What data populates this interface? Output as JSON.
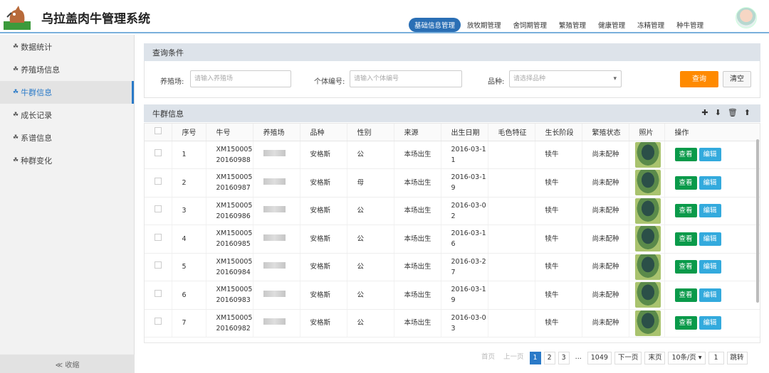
{
  "app": {
    "title": "乌拉盖肉牛管理系统"
  },
  "topnav": [
    "基础信息管理",
    "放牧期管理",
    "舍饲期管理",
    "繁殖管理",
    "健康管理",
    "冻精管理",
    "种牛管理"
  ],
  "sidebar": {
    "items": [
      {
        "label": "数据统计"
      },
      {
        "label": "养殖场信息"
      },
      {
        "label": "牛群信息"
      },
      {
        "label": "成长记录"
      },
      {
        "label": "系谱信息"
      },
      {
        "label": "种群变化"
      }
    ],
    "collapse_label": "≪ 收缩"
  },
  "query": {
    "title": "查询条件",
    "farm_label": "养殖场:",
    "farm_placeholder": "请输入养殖场",
    "id_label": "个体编号:",
    "id_placeholder": "请输入个体编号",
    "breed_label": "品种:",
    "breed_placeholder": "请选择品种",
    "query_btn": "查询",
    "clear_btn": "清空"
  },
  "table": {
    "title": "牛群信息",
    "headers": [
      "",
      "序号",
      "牛号",
      "养殖场",
      "品种",
      "性别",
      "来源",
      "出生日期",
      "毛色特征",
      "生长阶段",
      "繁殖状态",
      "照片",
      "操作"
    ],
    "view_label": "查看",
    "edit_label": "编辑",
    "rows": [
      {
        "no": "1",
        "id1": "XM150005",
        "id2": "20160988",
        "breed": "安格斯",
        "sex": "公",
        "source": "本场出生",
        "d1": "2016-03-1",
        "d2": "1",
        "coat": "",
        "stage": "犊牛",
        "status": "尚未配种"
      },
      {
        "no": "2",
        "id1": "XM150005",
        "id2": "20160987",
        "breed": "安格斯",
        "sex": "母",
        "source": "本场出生",
        "d1": "2016-03-1",
        "d2": "9",
        "coat": "",
        "stage": "犊牛",
        "status": "尚未配种"
      },
      {
        "no": "3",
        "id1": "XM150005",
        "id2": "20160986",
        "breed": "安格斯",
        "sex": "公",
        "source": "本场出生",
        "d1": "2016-03-0",
        "d2": "2",
        "coat": "",
        "stage": "犊牛",
        "status": "尚未配种"
      },
      {
        "no": "4",
        "id1": "XM150005",
        "id2": "20160985",
        "breed": "安格斯",
        "sex": "公",
        "source": "本场出生",
        "d1": "2016-03-1",
        "d2": "6",
        "coat": "",
        "stage": "犊牛",
        "status": "尚未配种"
      },
      {
        "no": "5",
        "id1": "XM150005",
        "id2": "20160984",
        "breed": "安格斯",
        "sex": "公",
        "source": "本场出生",
        "d1": "2016-03-2",
        "d2": "7",
        "coat": "",
        "stage": "犊牛",
        "status": "尚未配种"
      },
      {
        "no": "6",
        "id1": "XM150005",
        "id2": "20160983",
        "breed": "安格斯",
        "sex": "公",
        "source": "本场出生",
        "d1": "2016-03-1",
        "d2": "9",
        "coat": "",
        "stage": "犊牛",
        "status": "尚未配种"
      },
      {
        "no": "7",
        "id1": "XM150005",
        "id2": "20160982",
        "breed": "安格斯",
        "sex": "公",
        "source": "本场出生",
        "d1": "2016-03-0",
        "d2": "3",
        "coat": "",
        "stage": "犊牛",
        "status": "尚未配种"
      }
    ]
  },
  "pager": {
    "first": "首页",
    "prev": "上一页",
    "pages": [
      "1",
      "2",
      "3"
    ],
    "ellipsis": "...",
    "last_num": "1049",
    "next": "下一页",
    "last": "末页",
    "per_page": "10条/页 ▾",
    "goto_value": "1",
    "goto": "跳转"
  }
}
